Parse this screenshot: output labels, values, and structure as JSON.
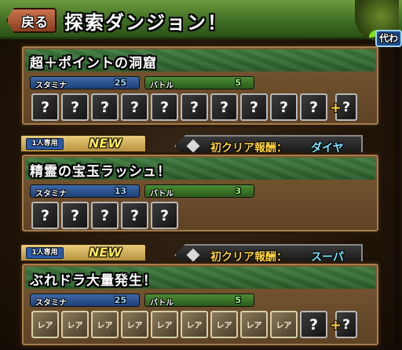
{
  "header": {
    "back_label": "戻る",
    "title": "探索ダンジョン！",
    "mascot_label": "代わ"
  },
  "dungeons": [
    {
      "name": "超＋ポイントの洞窟",
      "stamina_label": "スタミナ",
      "stamina": "25",
      "battle_label": "バトル",
      "battles": "5",
      "drops": [
        "?",
        "?",
        "?",
        "?",
        "?",
        "?",
        "?",
        "?",
        "?",
        "?"
      ],
      "plus_drop": "?"
    },
    {
      "solo_label": "1人専用",
      "new_label": "NEW",
      "reward_label": "初クリア報酬：",
      "reward_value": "ダイヤ",
      "name": "精霊の宝玉ラッシュ！",
      "stamina_label": "スタミナ",
      "stamina": "13",
      "battle_label": "バトル",
      "battles": "3",
      "drops": [
        "?",
        "?",
        "?",
        "?",
        "?"
      ]
    },
    {
      "solo_label": "1人専用",
      "new_label": "NEW",
      "reward_label": "初クリア報酬：",
      "reward_value": "スーパ",
      "name": "ぶれドラ大量発生！",
      "stamina_label": "スタミナ",
      "stamina": "25",
      "battle_label": "バトル",
      "battles": "5",
      "drops": [
        "レア",
        "レア",
        "レア",
        "レア",
        "レア",
        "レア",
        "レア",
        "レア",
        "レア",
        "?"
      ],
      "plus_drop": "?"
    }
  ]
}
